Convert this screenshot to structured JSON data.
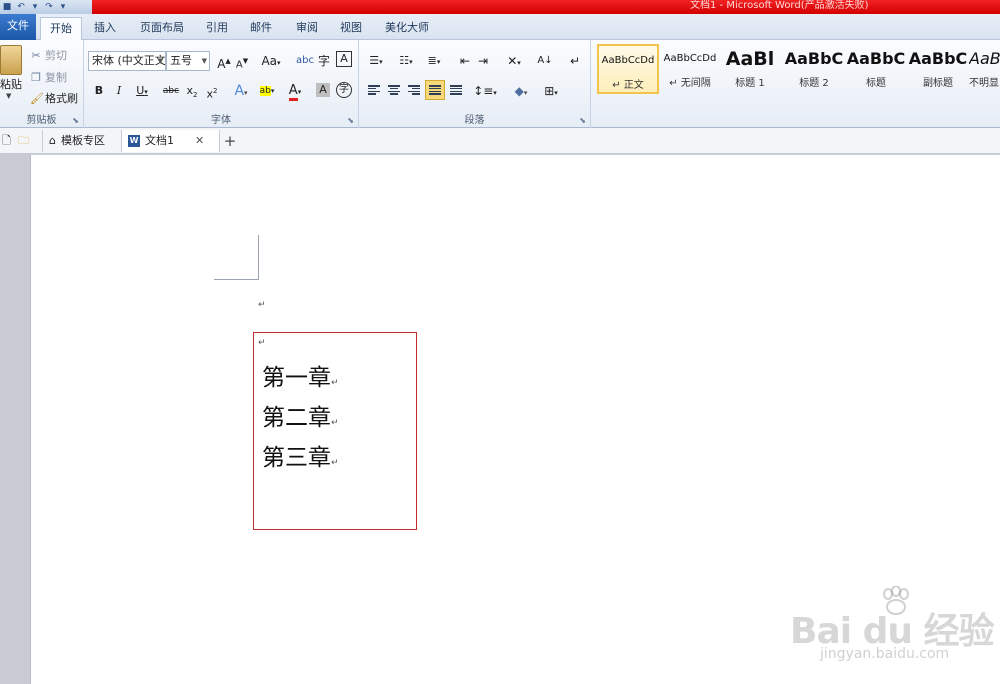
{
  "window": {
    "title": "文档1 - Microsoft Word(产品激活失败)"
  },
  "menu_tabs": {
    "file": "文件",
    "home": "开始",
    "insert": "插入",
    "page_layout": "页面布局",
    "references": "引用",
    "mailings": "邮件",
    "review": "审阅",
    "view": "视图",
    "beautify": "美化大师"
  },
  "clipboard": {
    "paste": "粘贴",
    "cut": "剪切",
    "copy": "复制",
    "format_painter": "格式刷",
    "group_label": "剪贴板"
  },
  "font": {
    "font_name": "宋体 (中文正文",
    "font_size": "五号",
    "group_label": "字体"
  },
  "paragraph": {
    "group_label": "段落"
  },
  "styles": [
    {
      "sample": "AaBbCcDd",
      "name": "↵ 正文"
    },
    {
      "sample": "AaBbCcDd",
      "name": "↵ 无间隔"
    },
    {
      "sample": "AaBl",
      "name": "标题 1"
    },
    {
      "sample": "AaBbC",
      "name": "标题 2"
    },
    {
      "sample": "AaBbC",
      "name": "标题"
    },
    {
      "sample": "AaBbC",
      "name": "副标题"
    },
    {
      "sample": "AaBbC",
      "name": "不明显"
    }
  ],
  "doc_tabs": {
    "template": "模板专区",
    "document": "文档1"
  },
  "document": {
    "paragraph_mark": "↵",
    "chapters": [
      "第一章",
      "第二章",
      "第三章"
    ]
  },
  "watermark": {
    "logo": "Bai du 经验",
    "url": "jingyan.baidu.com"
  },
  "colors": {
    "title_bar": "#d40000",
    "file_tab": "#1b57a8",
    "textbox_border": "#c03030",
    "selected_style": "#f2c44b"
  }
}
